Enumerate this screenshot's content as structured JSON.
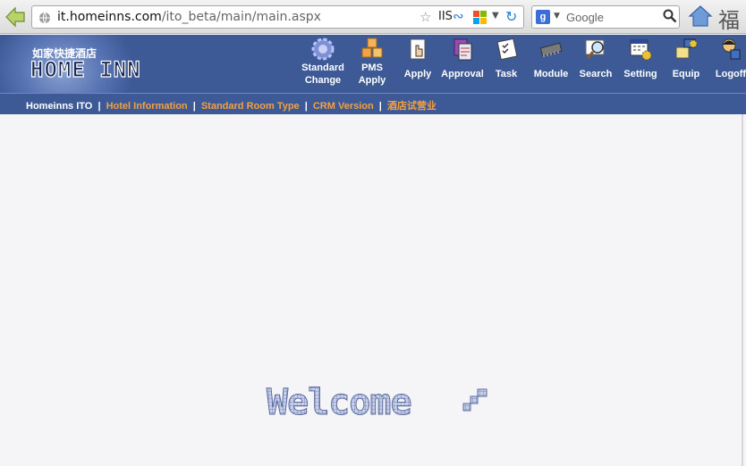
{
  "browser": {
    "url_host": "it.homeinns.com",
    "url_path": "/ito_beta/main/main.aspx",
    "addon_label": "IIS",
    "search_placeholder": "Google",
    "corner_glyph": "福"
  },
  "brand": {
    "name_cn": "如家快捷酒店",
    "name_en": "HOME INN"
  },
  "toolbar": {
    "items": [
      {
        "key": "standard-change",
        "label": "Standard Change",
        "icon": "gear-icon"
      },
      {
        "key": "pms-apply",
        "label": "PMS Apply",
        "icon": "boxes-icon"
      },
      {
        "key": "apply",
        "label": "Apply",
        "icon": "hand-pointer-icon"
      },
      {
        "key": "approval",
        "label": "Approval",
        "icon": "documents-icon"
      },
      {
        "key": "task",
        "label": "Task",
        "icon": "checklist-icon"
      },
      {
        "key": "module",
        "label": "Module",
        "icon": "chip-icon"
      },
      {
        "key": "search",
        "label": "Search",
        "icon": "magnifier-icon"
      },
      {
        "key": "setting",
        "label": "Setting",
        "icon": "calendar-gear-icon"
      },
      {
        "key": "equip",
        "label": "Equip",
        "icon": "computer-icon"
      },
      {
        "key": "logoff",
        "label": "Logoff",
        "icon": "user-logoff-icon"
      }
    ]
  },
  "breadcrumb": {
    "root": "Homeinns ITO",
    "links": [
      "Hotel Information",
      "Standard Room Type",
      "CRM Version",
      "酒店试营业"
    ],
    "separator": "|"
  },
  "welcome_text": "Welcome",
  "colors": {
    "header_bg": "#3d5a97",
    "link_orange": "#f4a040",
    "page_bg": "#f5f5f7"
  }
}
